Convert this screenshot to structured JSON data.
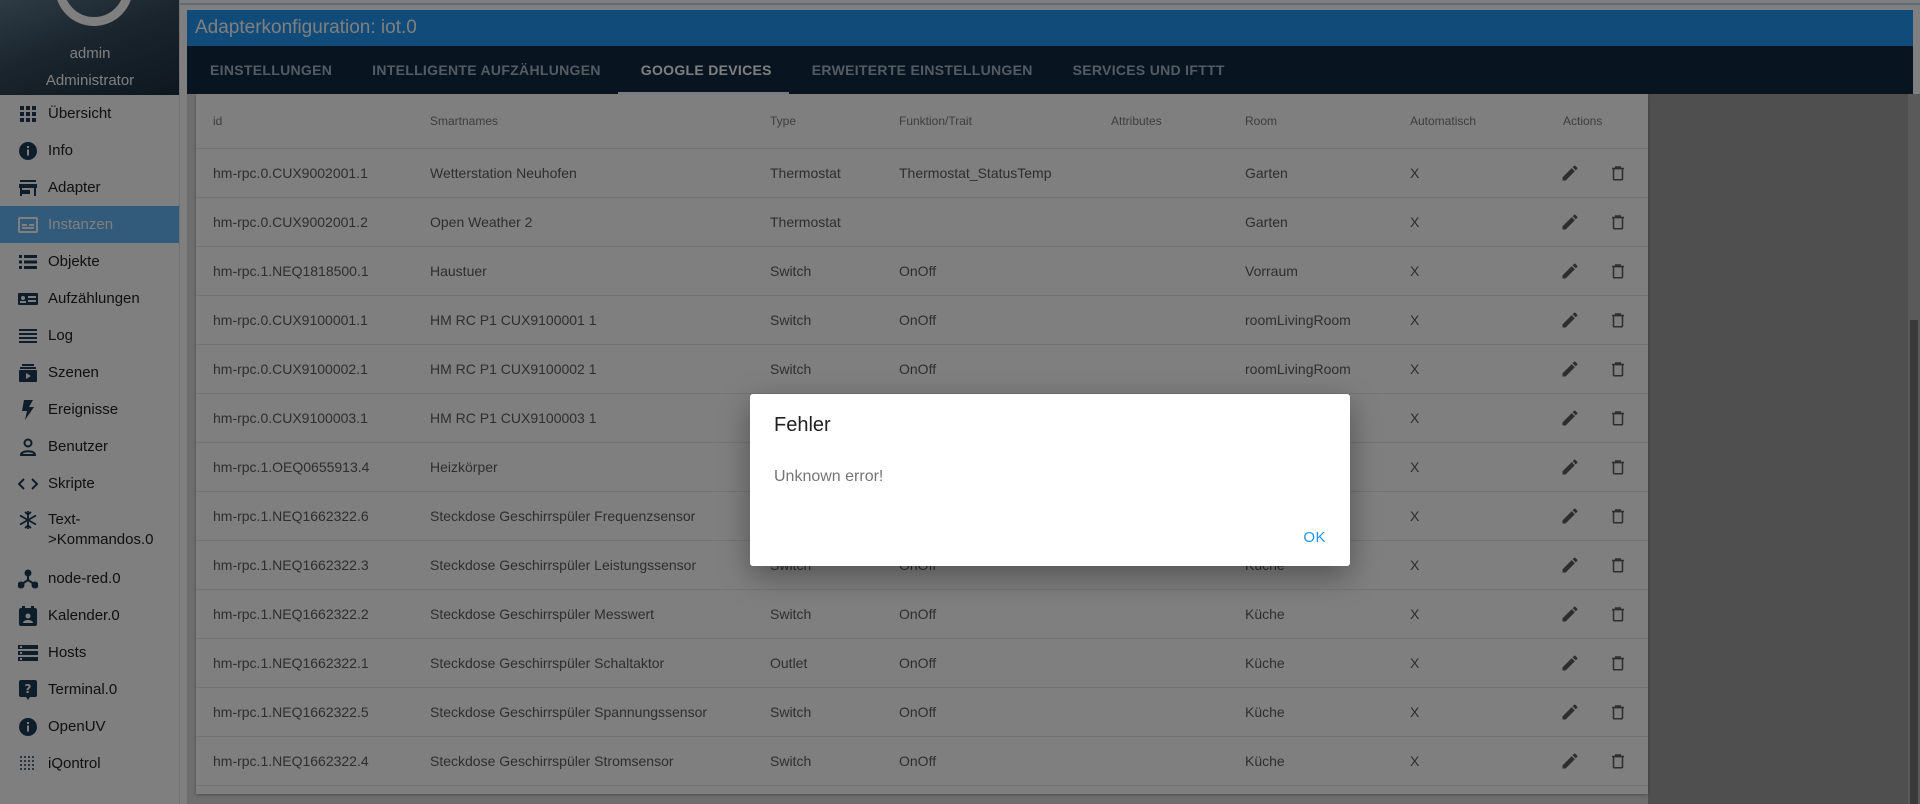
{
  "sidebar": {
    "user_name": "admin",
    "user_role": "Administrator",
    "items": [
      {
        "label": "Übersicht",
        "icon": "apps-grid-icon"
      },
      {
        "label": "Info",
        "icon": "info-icon"
      },
      {
        "label": "Adapter",
        "icon": "store-icon"
      },
      {
        "label": "Instanzen",
        "icon": "instances-icon",
        "active": true
      },
      {
        "label": "Objekte",
        "icon": "list-icon"
      },
      {
        "label": "Aufzählungen",
        "icon": "enum-card-icon"
      },
      {
        "label": "Log",
        "icon": "lines-icon"
      },
      {
        "label": "Szenen",
        "icon": "scenes-icon"
      },
      {
        "label": "Ereignisse",
        "icon": "bolt-icon"
      },
      {
        "label": "Benutzer",
        "icon": "person-icon"
      },
      {
        "label": "Skripte",
        "icon": "code-icon"
      },
      {
        "label": "Text->Kommandos.0",
        "icon": "snowflake-icon"
      },
      {
        "label": "node-red.0",
        "icon": "node-red-icon"
      },
      {
        "label": "Kalender.0",
        "icon": "calendar-icon"
      },
      {
        "label": "Hosts",
        "icon": "hosts-icon"
      },
      {
        "label": "Terminal.0",
        "icon": "terminal-help-icon"
      },
      {
        "label": "OpenUV",
        "icon": "info-icon"
      },
      {
        "label": "iQontrol",
        "icon": "dots-grid-icon"
      }
    ]
  },
  "title": "Adapterkonfiguration: iot.0",
  "tabs": [
    {
      "label": "EINSTELLUNGEN"
    },
    {
      "label": "INTELLIGENTE AUFZÄHLUNGEN"
    },
    {
      "label": "GOOGLE DEVICES",
      "active": true
    },
    {
      "label": "ERWEITERTE EINSTELLUNGEN"
    },
    {
      "label": "SERVICES UND IFTTT"
    }
  ],
  "table": {
    "columns": [
      "id",
      "Smartnames",
      "Type",
      "Funktion/Trait",
      "Attributes",
      "Room",
      "Automatisch",
      "Actions"
    ],
    "rows": [
      [
        "hm-rpc.0.CUX9002001.1",
        "Wetterstation Neuhofen",
        "Thermostat",
        "Thermostat_StatusTemp",
        "",
        "Garten",
        "X"
      ],
      [
        "hm-rpc.0.CUX9002001.2",
        "Open Weather 2",
        "Thermostat",
        "",
        "",
        "Garten",
        "X"
      ],
      [
        "hm-rpc.1.NEQ1818500.1",
        "Haustuer",
        "Switch",
        "OnOff",
        "",
        "Vorraum",
        "X"
      ],
      [
        "hm-rpc.0.CUX9100001.1",
        "HM RC P1 CUX9100001 1",
        "Switch",
        "OnOff",
        "",
        "roomLivingRoom",
        "X"
      ],
      [
        "hm-rpc.0.CUX9100002.1",
        "HM RC P1 CUX9100002 1",
        "Switch",
        "OnOff",
        "",
        "roomLivingRoom",
        "X"
      ],
      [
        "hm-rpc.0.CUX9100003.1",
        "HM RC P1 CUX9100003 1",
        "",
        "",
        "",
        "",
        "X"
      ],
      [
        "hm-rpc.1.OEQ0655913.4",
        "Heizkörper",
        "",
        "",
        "",
        "",
        "X"
      ],
      [
        "hm-rpc.1.NEQ1662322.6",
        "Steckdose Geschirrspüler Frequenzsensor",
        "",
        "",
        "",
        "",
        "X"
      ],
      [
        "hm-rpc.1.NEQ1662322.3",
        "Steckdose Geschirrspüler Leistungssensor",
        "Switch",
        "OnOff",
        "",
        "Küche",
        "X"
      ],
      [
        "hm-rpc.1.NEQ1662322.2",
        "Steckdose Geschirrspüler Messwert",
        "Switch",
        "OnOff",
        "",
        "Küche",
        "X"
      ],
      [
        "hm-rpc.1.NEQ1662322.1",
        "Steckdose Geschirrspüler Schaltaktor",
        "Outlet",
        "OnOff",
        "",
        "Küche",
        "X"
      ],
      [
        "hm-rpc.1.NEQ1662322.5",
        "Steckdose Geschirrspüler Spannungssensor",
        "Switch",
        "OnOff",
        "",
        "Küche",
        "X"
      ],
      [
        "hm-rpc.1.NEQ1662322.4",
        "Steckdose Geschirrspüler Stromsensor",
        "Switch",
        "OnOff",
        "",
        "Küche",
        "X"
      ]
    ]
  },
  "dialog": {
    "title": "Fehler",
    "message": "Unknown error!",
    "ok_label": "OK"
  },
  "colors": {
    "primary": "#2196f3",
    "tabbar": "#102a43",
    "active_menu": "#64b5f6"
  }
}
